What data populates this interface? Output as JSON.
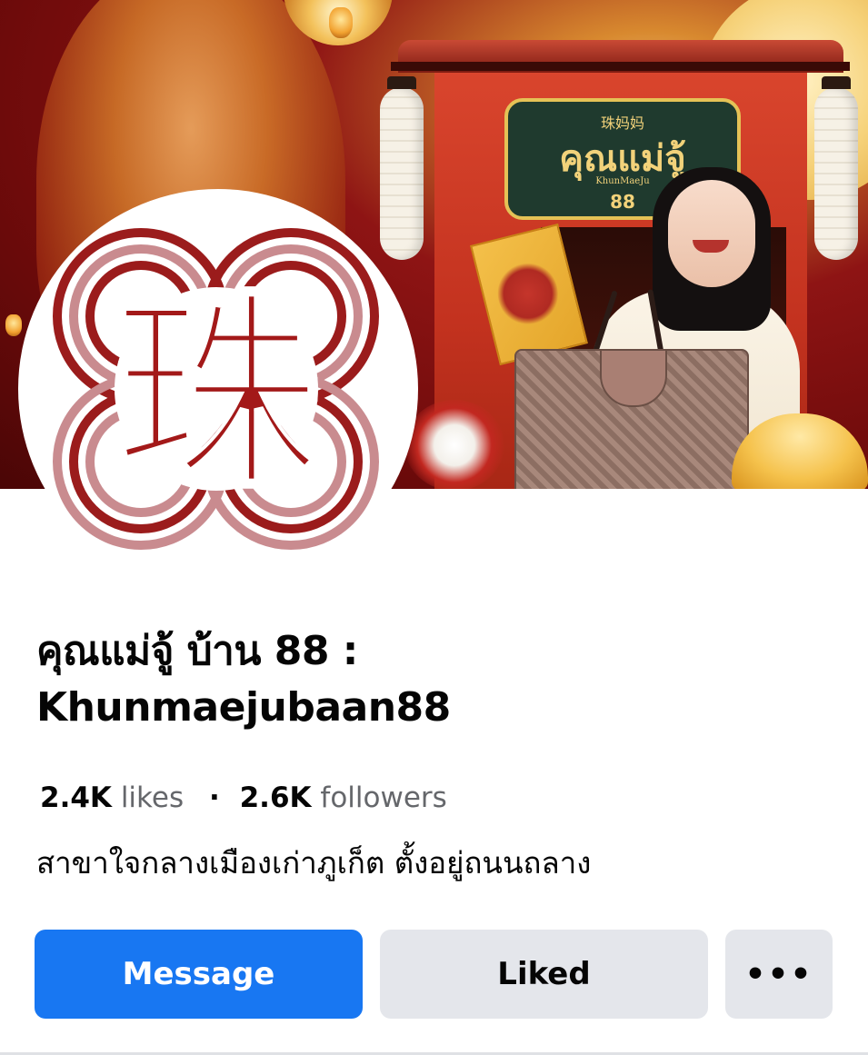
{
  "cover": {
    "sign_chinese": "珠妈妈",
    "sign_thai": "คุณแม่จู้",
    "sign_latin": "KhunMaeJu",
    "sign_number": "88"
  },
  "avatar": {
    "character": "珠",
    "colors": {
      "ring_dark": "#9b1c1c",
      "ring_light": "#c98b8f",
      "text": "#a31919"
    }
  },
  "page": {
    "title_line1": "คุณแม่จู้ บ้าน 88 :",
    "title_line2": "Khunmaejubaan88",
    "likes_count": "2.4K",
    "likes_label": "likes",
    "separator": "·",
    "followers_count": "2.6K",
    "followers_label": "followers",
    "description": "สาขาใจกลางเมืองเก่าภูเก็ต ตั้งอยู่ถนนถลาง"
  },
  "actions": {
    "message_label": "Message",
    "liked_label": "Liked",
    "more_label": "•••"
  },
  "theme": {
    "primary": "#1877f2",
    "secondary_button": "#e4e6eb",
    "muted_text": "#65676b"
  }
}
